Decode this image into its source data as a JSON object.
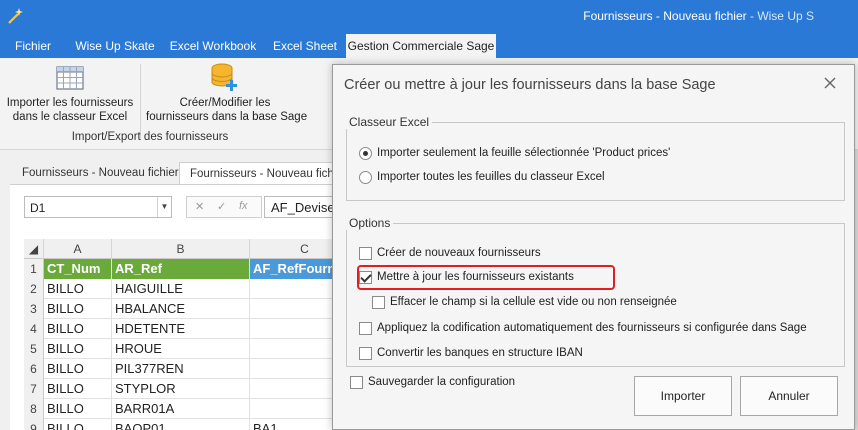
{
  "window": {
    "title": "Fournisseurs - Nouveau fichier",
    "app": "- Wise Up S",
    "icon": "magic-wand-icon"
  },
  "ribbon_tabs": [
    {
      "label": "Fichier",
      "active": false
    },
    {
      "label": "Wise Up Skate",
      "active": false
    },
    {
      "label": "Excel Workbook",
      "active": false
    },
    {
      "label": "Excel Sheet",
      "active": false
    },
    {
      "label": "Gestion Commerciale Sage",
      "active": true
    }
  ],
  "ribbon": {
    "import_button": {
      "line1": "Importer les fournisseurs",
      "line2": "dans le classeur Excel",
      "icon": "grid-table-icon"
    },
    "create_button": {
      "line1": "Créer/Modifier les",
      "line2": "fournisseurs dans la base Sage",
      "icon": "database-add-icon"
    },
    "group_label": "Import/Export des fournisseurs"
  },
  "workbook_tabs": [
    {
      "label": "Fournisseurs - Nouveau fichier",
      "active": false
    },
    {
      "label": "Fournisseurs - Nouveau fichi",
      "active": true
    }
  ],
  "formula_bar": {
    "name_box": "D1",
    "formula": "AF_Devise",
    "icons": [
      "cancel-icon",
      "confirm-icon",
      "function-icon"
    ],
    "cancel_glyph": "✕",
    "confirm_glyph": "✓",
    "fx_glyph": "fx"
  },
  "grid": {
    "columns": [
      "A",
      "B",
      "C"
    ],
    "rows": [
      {
        "num": "1",
        "a": "CT_Num",
        "b": "AR_Ref",
        "c": "AF_RefFourn",
        "header": true
      },
      {
        "num": "2",
        "a": "BILLO",
        "b": "HAIGUILLE",
        "c": ""
      },
      {
        "num": "3",
        "a": "BILLO",
        "b": "HBALANCE",
        "c": ""
      },
      {
        "num": "4",
        "a": "BILLO",
        "b": "HDETENTE",
        "c": ""
      },
      {
        "num": "5",
        "a": "BILLO",
        "b": "HROUE",
        "c": ""
      },
      {
        "num": "6",
        "a": "BILLO",
        "b": "PIL377REN",
        "c": ""
      },
      {
        "num": "7",
        "a": "BILLO",
        "b": "STYPLOR",
        "c": ""
      },
      {
        "num": "8",
        "a": "BILLO",
        "b": "BARR01A",
        "c": ""
      },
      {
        "num": "9",
        "a": "BILLO",
        "b": "BAOP01",
        "c": "BA1"
      }
    ]
  },
  "dialog": {
    "title": "Créer ou mettre à jour les fournisseurs dans la base Sage",
    "close_icon": "close-icon",
    "group_excel": {
      "legend": "Classeur Excel",
      "options": [
        {
          "label": "Importer seulement la feuille sélectionnée 'Product prices'",
          "selected": true
        },
        {
          "label": "Importer toutes les feuilles du classeur Excel",
          "selected": false
        }
      ]
    },
    "group_options": {
      "legend": "Options",
      "checkboxes": [
        {
          "label": "Créer de nouveaux fournisseurs",
          "checked": false
        },
        {
          "label": "Mettre à jour les fournisseurs existants",
          "checked": true
        },
        {
          "label": "Effacer le champ si la cellule est vide ou non renseignée",
          "checked": false
        },
        {
          "label": "Appliquez la codification automatiquement des fournisseurs si configurée dans Sage",
          "checked": false
        },
        {
          "label": "Convertir les banques en structure IBAN",
          "checked": false
        }
      ]
    },
    "save_config": {
      "label": "Sauvegarder la configuration",
      "checked": false
    },
    "import_button": "Importer",
    "cancel_button": "Annuler"
  }
}
